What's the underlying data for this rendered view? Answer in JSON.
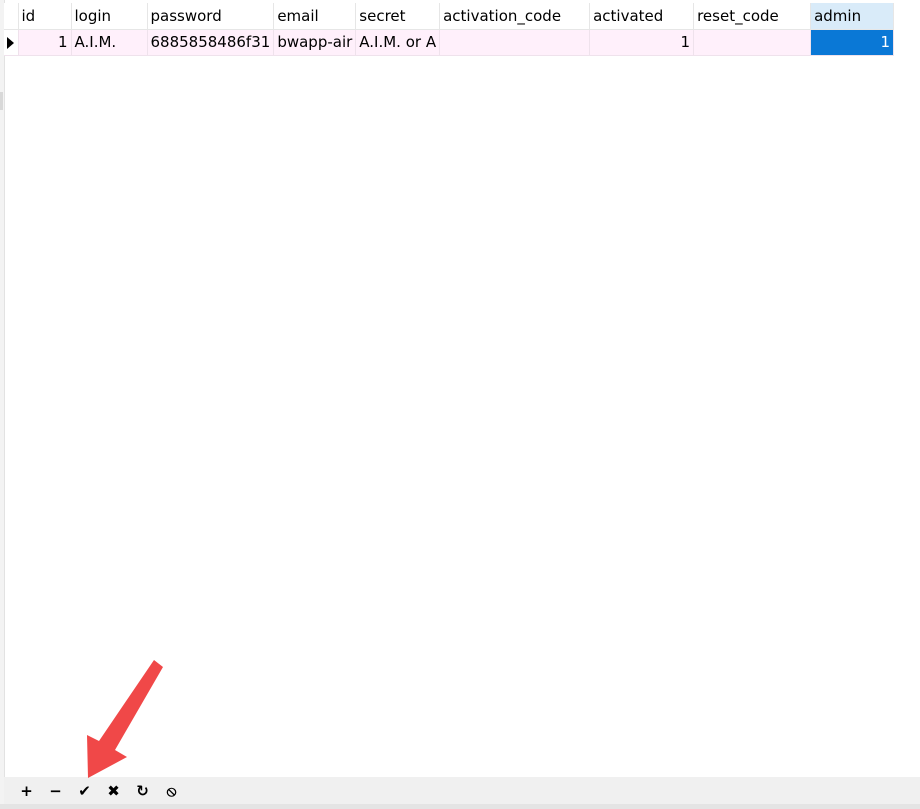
{
  "table": {
    "columns": [
      "id",
      "login",
      "password",
      "email",
      "secret",
      "activation_code",
      "activated",
      "reset_code",
      "admin"
    ],
    "rows": [
      {
        "id": "1",
        "login": "A.I.M.",
        "password": "6885858486f31",
        "email": "bwapp-air",
        "secret": "A.I.M. or A",
        "activation_code": "",
        "activated": "1",
        "reset_code": "",
        "admin": "1"
      }
    ],
    "selected_column": "admin",
    "colors": {
      "row_background": "#fff0fb",
      "selected_cell": "#0a78d6",
      "selected_header": "#d9ebf9"
    }
  },
  "toolbar": {
    "buttons": [
      {
        "name": "add-record",
        "glyph": "+",
        "icon": "plus-icon"
      },
      {
        "name": "delete-record",
        "glyph": "−",
        "icon": "minus-icon"
      },
      {
        "name": "apply-changes",
        "glyph": "✔",
        "icon": "check-icon"
      },
      {
        "name": "discard-changes",
        "glyph": "✖",
        "icon": "close-icon"
      },
      {
        "name": "refresh",
        "glyph": "↻",
        "icon": "refresh-icon"
      },
      {
        "name": "stop",
        "glyph": "⦸",
        "icon": "stop-icon"
      }
    ]
  },
  "annotation": {
    "color": "#f04848",
    "icon": "red-arrow-icon"
  }
}
